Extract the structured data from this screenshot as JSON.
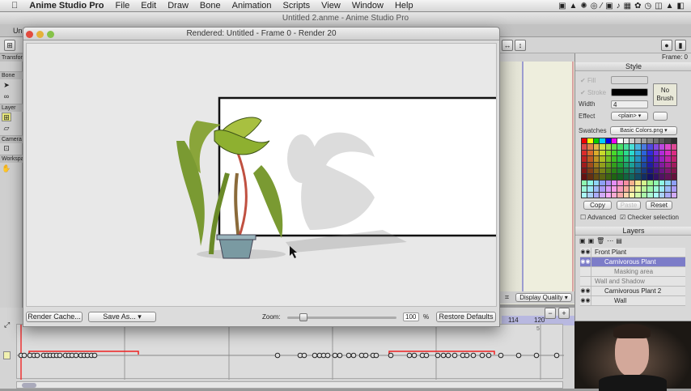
{
  "menubar": {
    "apple": "",
    "app": "Anime Studio Pro",
    "items": [
      "File",
      "Edit",
      "Draw",
      "Bone",
      "Animation",
      "Scripts",
      "View",
      "Window",
      "Help"
    ]
  },
  "main_window": {
    "title": "Untitled 2.anme - Anime Studio Pro",
    "tab": "Un",
    "frame_label": "Frame: 0"
  },
  "tools": {
    "sections": [
      "Transform",
      "Bone",
      "Layer",
      "Camera",
      "Workspace"
    ]
  },
  "render_window": {
    "title": "Rendered: Untitled - Frame 0 - Render 20",
    "render_cache": "Render Cache...",
    "save_as": "Save As...",
    "zoom_label": "Zoom:",
    "zoom_value": "100",
    "zoom_unit": "%",
    "zoom_fraction": 0.12,
    "restore_defaults": "Restore Defaults"
  },
  "canvas_toolbar": {
    "display_quality": "Display Quality"
  },
  "style": {
    "header": "Style",
    "fill": "Fill",
    "stroke": "Stroke",
    "width_label": "Width",
    "width_value": "4",
    "effect_label": "Effect",
    "effect_value": "<plain>",
    "no_brush": "No Brush",
    "swatches_label": "Swatches",
    "swatches_value": "Basic Colors.png",
    "copy": "Copy",
    "paste": "Paste",
    "reset": "Reset",
    "advanced": "Advanced",
    "checker": "Checker selection",
    "fill_color": "#ffffff",
    "stroke_color": "#000000"
  },
  "layers": {
    "header": "Layers",
    "items": [
      {
        "name": "Front Plant",
        "level": 0,
        "visible": true,
        "selected": false
      },
      {
        "name": "Carnivorous Plant",
        "level": 1,
        "visible": true,
        "selected": true
      },
      {
        "name": "Masking area",
        "level": 2,
        "visible": false,
        "selected": false
      },
      {
        "name": "Wall and Shadow",
        "level": 0,
        "visible": false,
        "selected": false
      },
      {
        "name": "Carnivorous Plant 2",
        "level": 1,
        "visible": true,
        "selected": false
      },
      {
        "name": "Wall",
        "level": 2,
        "visible": true,
        "selected": false
      }
    ]
  },
  "timeline": {
    "frame_labels": [
      "114",
      "120"
    ],
    "marker": "5"
  }
}
